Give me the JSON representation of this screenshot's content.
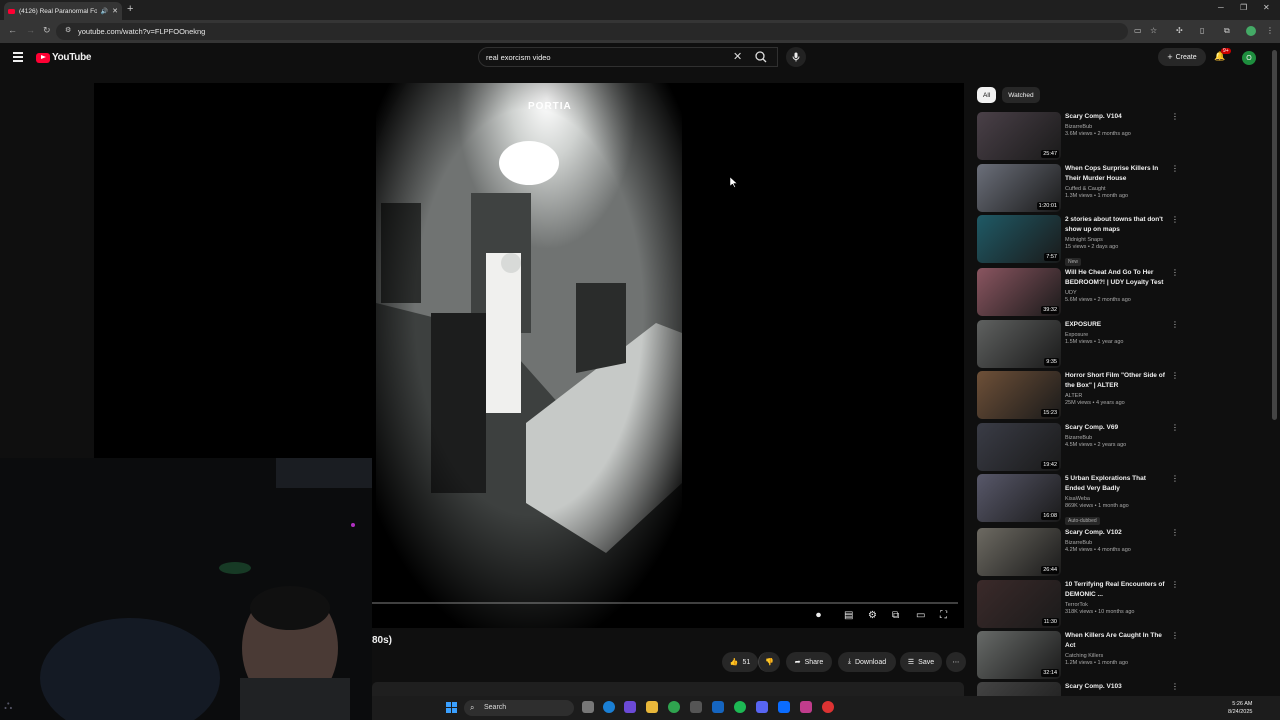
{
  "browser": {
    "tab_title": "(4126) Real Paranormal Foo...",
    "url": "youtube.com/watch?v=FLPFOOnekng"
  },
  "header": {
    "logo_text": "YouTube",
    "search_query": "real exorcism video",
    "create_label": "Create",
    "notif_count": "9+",
    "avatar_letter": "O"
  },
  "player": {
    "overlay_text": "PORTIA"
  },
  "video": {
    "title_fragment": "80s)",
    "likes": "51",
    "share_label": "Share",
    "download_label": "Download",
    "save_label": "Save"
  },
  "sidebar": {
    "chips": [
      {
        "label": "All"
      },
      {
        "label": "Watched"
      }
    ],
    "items": [
      {
        "title": "Scary Comp. V104",
        "channel": "BizarreBub",
        "stats": "3.6M views • 2 months ago",
        "duration": "25:47",
        "badge": "",
        "thumb": "#4a4048"
      },
      {
        "title": "When Cops Surprise Killers In Their Murder House",
        "channel": "Cuffed & Caught",
        "stats": "1.3M views • 1 month ago",
        "duration": "1:20:01",
        "badge": "",
        "thumb": "#6b6f7a"
      },
      {
        "title": "2 stories about towns that don't show up on maps",
        "channel": "Midnight Snaps",
        "stats": "15 views • 2 days ago",
        "duration": "7:57",
        "badge": "New",
        "thumb": "#1f5a66"
      },
      {
        "title": "Will He Cheat And Go To Her BEDROOM?! | UDY Loyalty Test",
        "channel": "UDY",
        "stats": "5.6M views • 2 months ago",
        "duration": "39:32",
        "badge": "",
        "thumb": "#8a5560"
      },
      {
        "title": "EXPOSURE",
        "channel": "Exposure",
        "stats": "1.5M views • 1 year ago",
        "duration": "9:35",
        "badge": "",
        "thumb": "#5f6160"
      },
      {
        "title": "Horror Short Film \"Other Side of the Box\" | ALTER",
        "channel": "ALTER",
        "stats": "25M views • 4 years ago",
        "duration": "15:23",
        "badge": "",
        "thumb": "#6e5038"
      },
      {
        "title": "Scary Comp. V69",
        "channel": "BizarreBub",
        "stats": "4.5M views • 2 years ago",
        "duration": "19:42",
        "badge": "",
        "thumb": "#3a3c46"
      },
      {
        "title": "5 Urban Explorations That Ended Very Badly",
        "channel": "KisaWeba",
        "stats": "869K views • 1 month ago",
        "duration": "16:08",
        "badge": "Auto-dubbed",
        "thumb": "#58586a"
      },
      {
        "title": "Scary Comp. V102",
        "channel": "BizarreBub",
        "stats": "4.2M views • 4 months ago",
        "duration": "26:44",
        "badge": "",
        "thumb": "#6d6a62"
      },
      {
        "title": "10 Terrifying Real Encounters of DEMONIC ...",
        "channel": "TerrorTok",
        "stats": "318K views • 10 months ago",
        "duration": "11:30",
        "badge": "",
        "thumb": "#3b2a2a"
      },
      {
        "title": "When Killers Are Caught In The Act",
        "channel": "Catching Killers",
        "stats": "1.2M views • 1 month ago",
        "duration": "32:14",
        "badge": "",
        "thumb": "#676a68"
      },
      {
        "title": "Scary Comp. V103",
        "channel": "",
        "stats": "",
        "duration": "",
        "badge": "",
        "thumb": "#444"
      }
    ]
  },
  "taskbar": {
    "search_label": "Search",
    "time": "5:26 AM",
    "date": "8/24/2025"
  }
}
